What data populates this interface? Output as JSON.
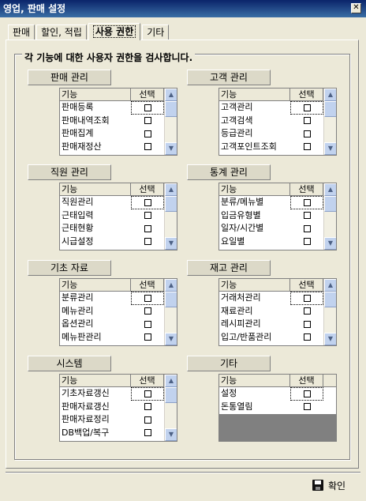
{
  "window": {
    "title": "영업, 판매 설정",
    "close": "✕"
  },
  "tabs": [
    {
      "label": "판매"
    },
    {
      "label": "할인, 적립"
    },
    {
      "label": "사용 권한"
    },
    {
      "label": "기타"
    }
  ],
  "group_title": "각 기능에 대한 사용자 권한을 검사합니다.",
  "grid_headers": {
    "function": "기능",
    "select": "선택"
  },
  "sections": [
    {
      "label": "판매 관리",
      "items": [
        "판매등록",
        "판매내역조회",
        "판매집계",
        "판매재정산"
      ]
    },
    {
      "label": "고객 관리",
      "items": [
        "고객관리",
        "고객검색",
        "등급관리",
        "고객포인트조회"
      ]
    },
    {
      "label": "직원 관리",
      "items": [
        "직원관리",
        "근태입력",
        "근태현황",
        "시급설정"
      ]
    },
    {
      "label": "통계 관리",
      "items": [
        "분류/메뉴별",
        "입금유형별",
        "일자/시간별",
        "요일별"
      ]
    },
    {
      "label": "기초 자료",
      "items": [
        "분류관리",
        "메뉴관리",
        "옵션관리",
        "메뉴판관리"
      ]
    },
    {
      "label": "재고 관리",
      "items": [
        "거래처관리",
        "재료관리",
        "레시피관리",
        "입고/반품관리"
      ]
    },
    {
      "label": "시스템",
      "items": [
        "기초자료갱신",
        "판매자료갱신",
        "판매자료정리",
        "DB백업/복구"
      ]
    },
    {
      "label": "기타",
      "items": [
        "설정",
        "돈통열림"
      ]
    }
  ],
  "ok_button": {
    "label": "확인"
  },
  "icons": {
    "scroll_up": "▲",
    "scroll_down": "▼",
    "save": "save-disk-icon"
  }
}
